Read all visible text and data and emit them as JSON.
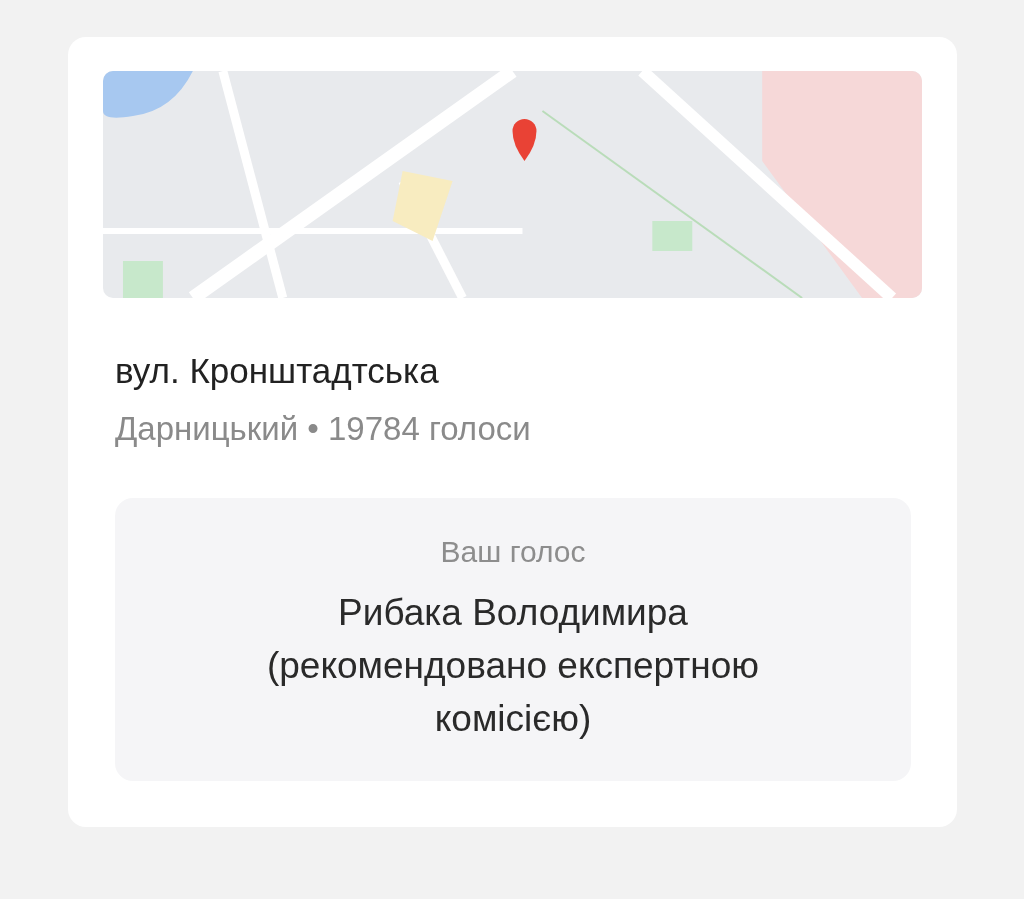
{
  "card": {
    "street": "вул. Кронштадтська",
    "subtitle": "Дарницький • 19784 голоси",
    "vote": {
      "label": "Ваш голос",
      "choice": "Рибака Володимира (рекомендовано експертною комісією)"
    }
  }
}
